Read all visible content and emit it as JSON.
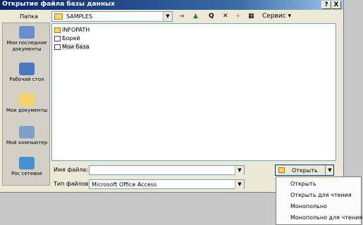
{
  "window": {
    "title": "Открытие файла базы данных",
    "help": "?",
    "close": "X"
  },
  "lookin": {
    "label": "Папка",
    "value": "SAMPLES"
  },
  "toolbar": {
    "back": "◄",
    "up": "▲",
    "search": "Q",
    "delete": "✕",
    "newfolder": "+",
    "views": "▦",
    "tools_label": "Сервис"
  },
  "places": [
    {
      "label": "Мои последние документы",
      "icon": "recent-documents-icon",
      "color": "#6a8fcc"
    },
    {
      "label": "Рабочий стол",
      "icon": "desktop-icon",
      "color": "#4a78c0"
    },
    {
      "label": "Мои документы",
      "icon": "my-documents-icon",
      "color": "#f3d46a"
    },
    {
      "label": "Мой компьютер",
      "icon": "my-computer-icon",
      "color": "#7fa0c8"
    },
    {
      "label": "Рос сетевое",
      "icon": "network-places-icon",
      "color": "#4a8fd0"
    }
  ],
  "files": [
    {
      "name": "INFOPATH",
      "type": "folder"
    },
    {
      "name": "Борей",
      "type": "mdb"
    },
    {
      "name": "Мои база",
      "type": "mdb"
    }
  ],
  "filename": {
    "label": "Имя файла:",
    "value": ""
  },
  "filetype": {
    "label": "Тип файлов:",
    "value": "Microsoft Office Access"
  },
  "open_button": {
    "label": "Открыть"
  },
  "menu": {
    "items": [
      "Открыть",
      "Открыть для чтения",
      "Монопольно",
      "Монопольно для чтения"
    ]
  }
}
